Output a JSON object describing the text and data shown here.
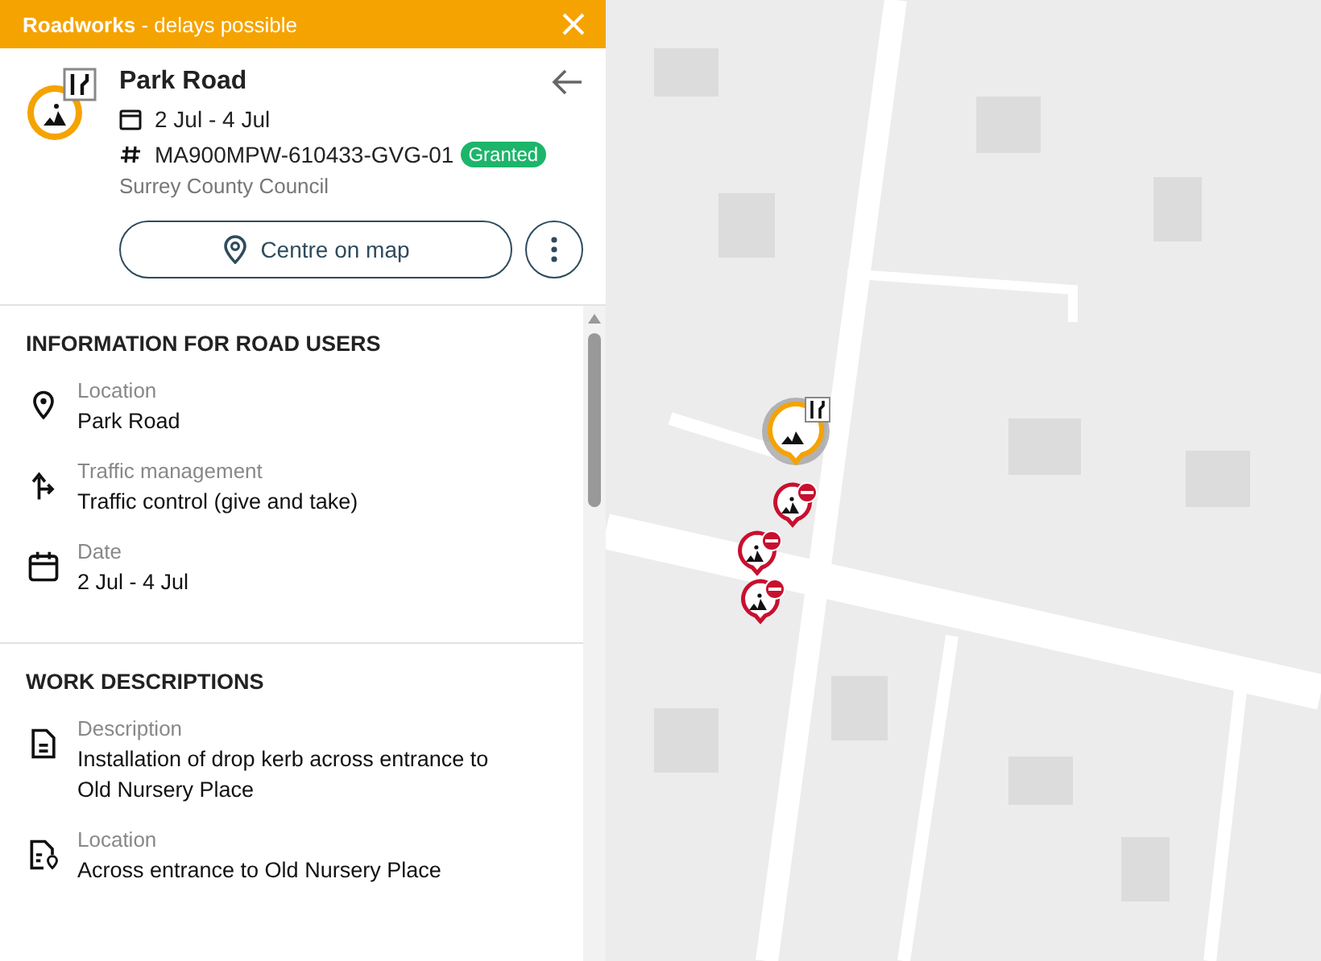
{
  "banner": {
    "text": "**Roadworks** - delays possible"
  },
  "header": {
    "title": "Park Road",
    "dates": "2 Jul - 4 Jul",
    "reference": "MA900MPW-610433-GVG-01",
    "status": "Granted",
    "organisation": "Surrey County Council"
  },
  "actions": {
    "centre_button": "Centre on map"
  },
  "sections": [
    {
      "title": "INFORMATION FOR ROAD USERS",
      "items": [
        {
          "kind": "location",
          "label": "Location",
          "value": "Park Road"
        },
        {
          "kind": "traffic",
          "label": "Traffic management",
          "value": "Traffic control (give and take)"
        },
        {
          "kind": "date",
          "label": "Date",
          "value": "2 Jul - 4 Jul"
        }
      ]
    },
    {
      "title": "WORK DESCRIPTIONS",
      "items": [
        {
          "kind": "description",
          "label": "Description",
          "value": "Installation of drop kerb across entrance to Old Nursery Place"
        },
        {
          "kind": "work-location",
          "label": "Location",
          "value": "Across entrance to Old Nursery Place"
        }
      ]
    }
  ]
}
